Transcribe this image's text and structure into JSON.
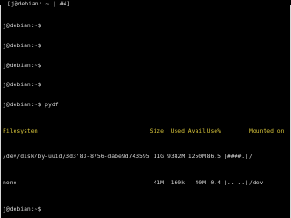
{
  "window": {
    "title": "[j@debian: ~ | #4]"
  },
  "terminal": {
    "prompt_lines_before": [
      "j@debian:~$",
      "j@debian:~$",
      "j@debian:~$",
      "j@debian:~$",
      "j@debian:~$ pydf"
    ],
    "header": {
      "filesystem": "Filesystem",
      "size": "Size",
      "used": "Used",
      "avail": "Avail",
      "use_percent": "Use%",
      "mounted_on": "Mounted on"
    },
    "rows": [
      {
        "filesystem": "/dev/disk/by-uuid/3d3'83-8756-dabe9d743595",
        "size": "11G",
        "used": "9382M",
        "avail": "1250M",
        "use_percent": "86.5",
        "bar": "[####.]",
        "mount": "/"
      },
      {
        "filesystem": "none",
        "size": "41M",
        "used": "160k",
        "avail": "40M",
        "use_percent": "0.4",
        "bar": "[.....]",
        "mount": "/dev"
      }
    ],
    "prompt_lines_after": [
      "j@debian:~$"
    ]
  },
  "colors": {
    "background": "#000000",
    "text": "#d8d8d8",
    "header": "#d7c43a"
  }
}
